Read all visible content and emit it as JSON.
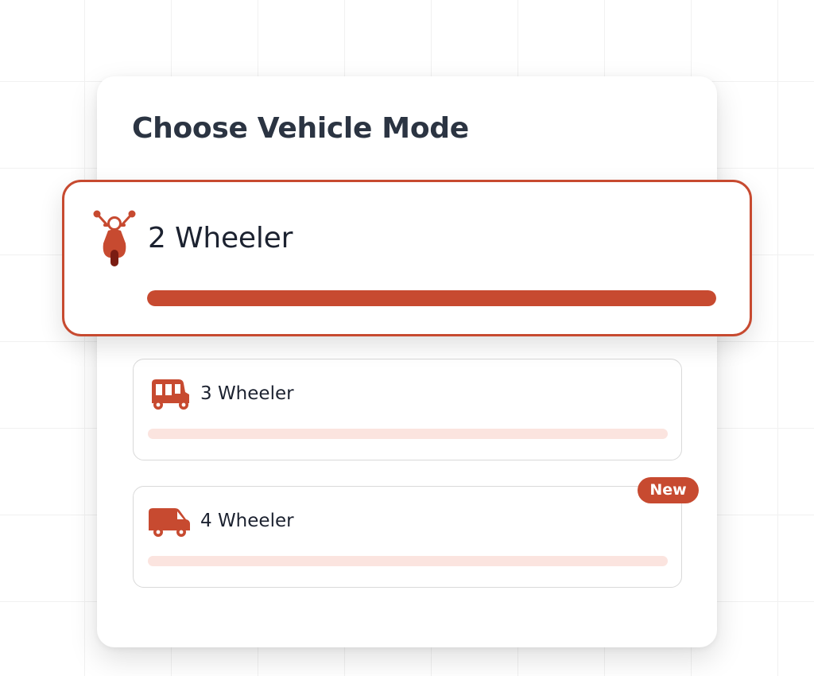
{
  "title": "Choose Vehicle Mode",
  "colors": {
    "accent": "#c74a30",
    "track": "#fbe4df",
    "text": "#1c2230"
  },
  "options": [
    {
      "label": "2 Wheeler",
      "icon": "scooter-icon",
      "selected": true,
      "progress": 1.0
    },
    {
      "label": "3 Wheeler",
      "icon": "auto-rickshaw-icon",
      "selected": false,
      "progress": 0
    },
    {
      "label": "4 Wheeler",
      "icon": "van-icon",
      "selected": false,
      "progress": 0,
      "badge": "New"
    }
  ]
}
